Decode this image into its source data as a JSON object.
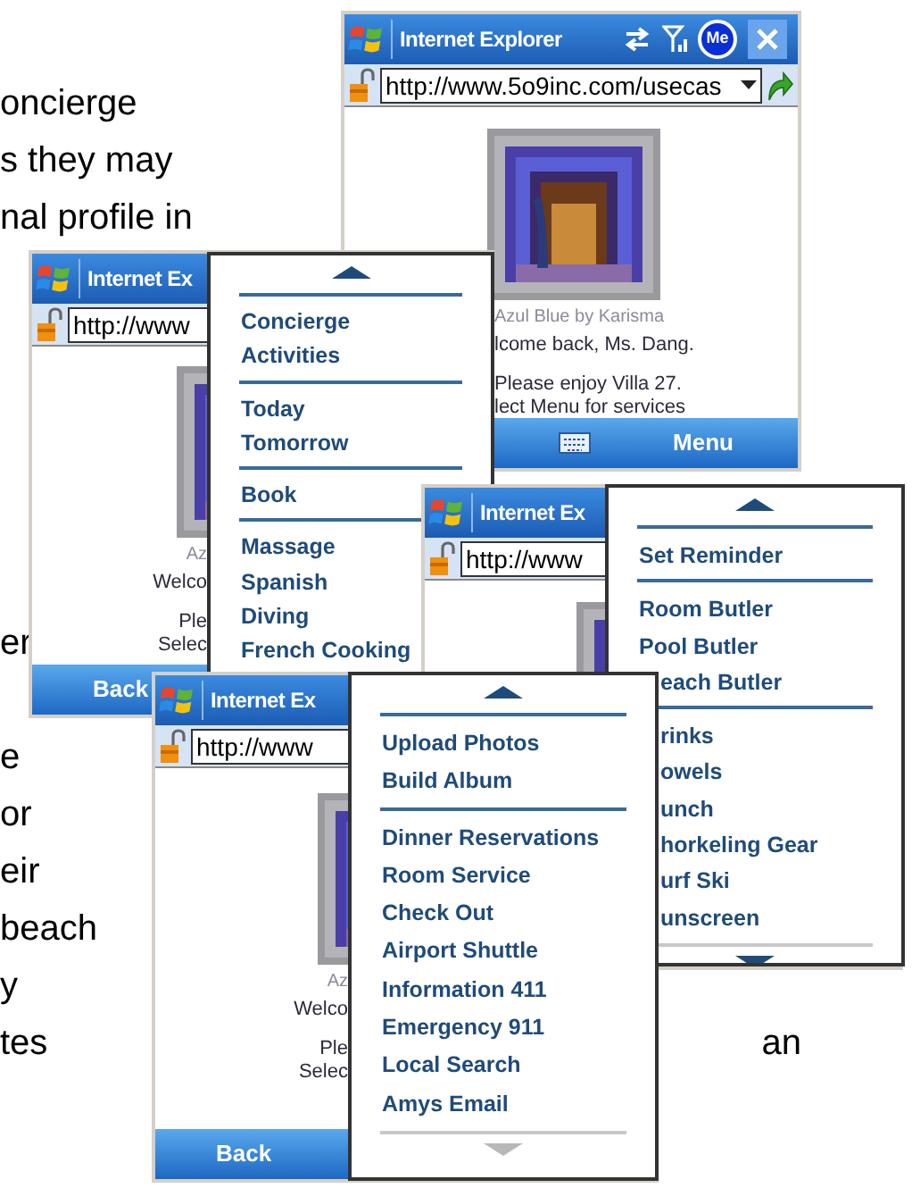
{
  "document_text": {
    "top_lines": [
      "oncierge",
      "s they may",
      "nal profile in"
    ],
    "bottom_lines": [
      "er",
      "e",
      "or",
      "eir",
      "beach",
      "y",
      "tes"
    ],
    "bottom_trailing": "an"
  },
  "windows": [
    {
      "title": "Internet Explorer",
      "status_badge": "Me",
      "url": "http://www.5o9inc.com/usecas",
      "url_dropdown": true,
      "texts": [
        {
          "kind": "caption",
          "text": "Azul Blue by Karisma"
        },
        {
          "kind": "line",
          "text": "lcome back, Ms. Dang."
        },
        {
          "kind": "gap_line",
          "text": "Please enjoy Villa 27."
        },
        {
          "kind": "line",
          "text": "lect Menu for services"
        }
      ],
      "soft_keys": {
        "keyboard": true,
        "right": "Menu"
      }
    },
    {
      "title": "Internet Ex",
      "url": "http://www",
      "texts": [
        {
          "kind": "caption",
          "text": "Az"
        },
        {
          "kind": "line",
          "text": "Welco"
        },
        {
          "kind": "gap_line",
          "text": "Ple"
        },
        {
          "kind": "line",
          "text": "Selec"
        }
      ],
      "soft_keys": {
        "left": "Back"
      },
      "menu": {
        "groups": [
          [
            "Concierge",
            "Activities"
          ],
          [
            "Today",
            "Tomorrow"
          ],
          [
            "Book"
          ],
          [
            "Massage",
            "Spanish",
            "Diving",
            "French Cooking"
          ]
        ]
      }
    },
    {
      "title": "Internet Ex",
      "url": "http://www",
      "menu": {
        "groups": [
          [
            "Set Reminder"
          ],
          [
            "Room Butler",
            "Pool Butler",
            "each Butler"
          ],
          [
            "rinks",
            "owels",
            "unch",
            "horkeling Gear",
            "urf Ski",
            "unscreen"
          ]
        ],
        "scroll_down": {
          "disabled": false
        }
      }
    },
    {
      "title": "Internet Ex",
      "url": "http://www",
      "texts": [
        {
          "kind": "caption",
          "text": "Az"
        },
        {
          "kind": "line",
          "text": "Welco"
        },
        {
          "kind": "gap_line",
          "text": "Ple"
        },
        {
          "kind": "line",
          "text": "Selec"
        }
      ],
      "soft_keys": {
        "left": "Back"
      },
      "menu": {
        "groups": [
          [
            "Upload Photos",
            "Build Album"
          ],
          [
            "Dinner Reservations",
            "Room Service",
            "Check Out",
            "Airport Shuttle",
            "Information 411",
            "Emergency 911",
            "Local Search",
            "Amys Email"
          ]
        ],
        "scroll_down": {
          "disabled": true
        }
      }
    }
  ]
}
